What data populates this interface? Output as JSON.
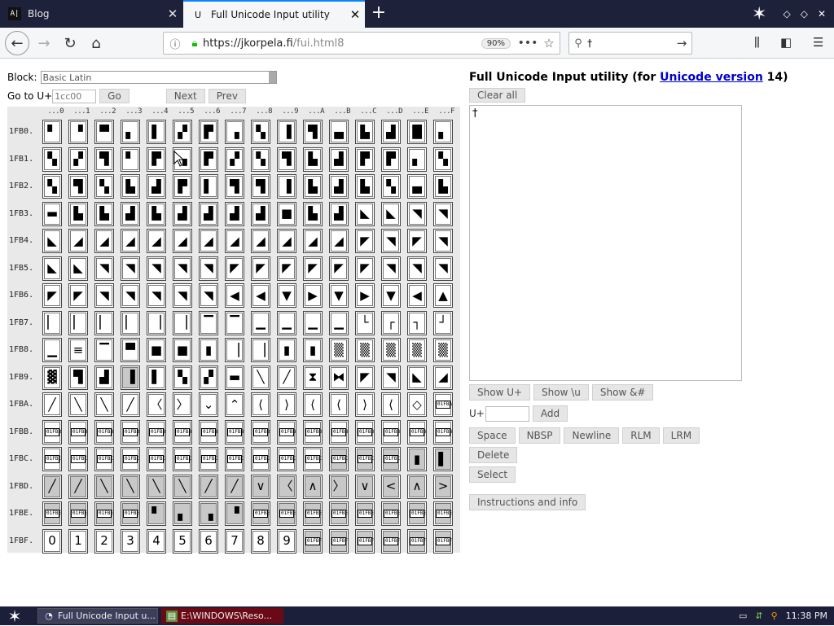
{
  "browser": {
    "tabs": [
      {
        "title": "Blog",
        "favicon": "A|"
      },
      {
        "title": "Full Unicode Input utility",
        "favicon": "U"
      }
    ],
    "url_prefix": "https://jkorpela.fi",
    "url_path": "/fui.html8",
    "zoom": "90%",
    "search_value": "†"
  },
  "page": {
    "block_label": "Block:",
    "block_value": "Basic Latin",
    "goto_label": "Go to U+",
    "goto_value": "1cc00",
    "go_label": "Go",
    "next_label": "Next",
    "prev_label": "Prev",
    "title_prefix": "Full Unicode Input utility (for ",
    "title_link": "Unicode version",
    "title_suffix": " 14)",
    "clear_label": "Clear all",
    "textarea_value": "†",
    "show_buttons": [
      "Show U+",
      "Show \\u",
      "Show &#"
    ],
    "add_prefix": "U+",
    "add_label": "Add",
    "insert_buttons": [
      "Space",
      "NBSP",
      "Newline",
      "RLM",
      "LRM"
    ],
    "delete_label": "Delete",
    "select_label": "Select",
    "instructions_label": "Instructions and info"
  },
  "grid": {
    "column_headers": [
      "...0",
      "...1",
      "...2",
      "...3",
      "...4",
      "...5",
      "...6",
      "...7",
      "...8",
      "...9",
      "...A",
      "...B",
      "...C",
      "...D",
      "...E",
      "...F"
    ],
    "rows": [
      {
        "label": "1FB0.",
        "cells": [
          "▘",
          "▝",
          "▀",
          "▖",
          "▌",
          "▞",
          "▛",
          "▗",
          "▚",
          "▐",
          "▜",
          "▄",
          "▙",
          "▟",
          "█",
          "▖"
        ],
        "shaded": []
      },
      {
        "label": "1FB1.",
        "cells": [
          "▚",
          "▞",
          "▜",
          "▘",
          "▛",
          "▗",
          "▛",
          "▞",
          "▚",
          "▜",
          "▙",
          "▟",
          "▛",
          "▛",
          "▖",
          "▚"
        ],
        "shaded": []
      },
      {
        "label": "1FB2.",
        "cells": [
          "▚",
          "▜",
          "▚",
          "▙",
          "▟",
          "▛",
          "▌",
          "▜",
          "▜",
          "▐",
          "▙",
          "▟",
          "▙",
          "▚",
          "▄",
          "▙"
        ],
        "shaded": []
      },
      {
        "label": "1FB3.",
        "cells": [
          "▬",
          "▙",
          "▙",
          "▟",
          "▙",
          "▟",
          "▟",
          "▟",
          "▟",
          "■",
          "▙",
          "▟",
          "◣",
          "◣",
          "◥",
          "◥"
        ],
        "shaded": []
      },
      {
        "label": "1FB4.",
        "cells": [
          "◣",
          "◢",
          "◢",
          "◢",
          "◢",
          "◢",
          "◢",
          "◢",
          "◢",
          "◢",
          "◢",
          "◢",
          "◤",
          "◥",
          "◤",
          "◥"
        ],
        "shaded": []
      },
      {
        "label": "1FB5.",
        "cells": [
          "◣",
          "◣",
          "◥",
          "◥",
          "◥",
          "◥",
          "◥",
          "◤",
          "◤",
          "◤",
          "◤",
          "◤",
          "◤",
          "◥",
          "◥",
          "◥"
        ],
        "shaded": []
      },
      {
        "label": "1FB6.",
        "cells": [
          "◤",
          "◤",
          "◥",
          "◥",
          "◥",
          "◥",
          "◥",
          "◀",
          "◀",
          "▼",
          "▶",
          "▼",
          "▶",
          "▼",
          "◀",
          "▲"
        ],
        "shaded": []
      },
      {
        "label": "1FB7.",
        "cells": [
          "▏",
          "▏",
          "▏",
          "▏",
          "▕",
          "▕",
          "▔",
          "▔",
          "▁",
          "▁",
          "▁",
          "▁",
          "└",
          "┌",
          "┐",
          "┘"
        ],
        "shaded": []
      },
      {
        "label": "1FB8.",
        "cells": [
          "▁",
          "≡",
          "▔",
          "▀",
          "■",
          "■",
          "▮",
          "▕",
          "▕",
          "▮",
          "▮",
          "▒",
          "▒",
          "▒",
          "▒",
          "▒"
        ],
        "shaded": []
      },
      {
        "label": "1FB9.",
        "cells": [
          "▓",
          "▜",
          "▟",
          "▐",
          "▌",
          "▚",
          "▞",
          "▬",
          "╲",
          "╱",
          "⧗",
          "⧓",
          "◤",
          "◥",
          "◣",
          "◢"
        ],
        "shaded": [
          3
        ]
      },
      {
        "label": "1FBA.",
        "cells": [
          "╱",
          "╲",
          "╲",
          "╱",
          "〈",
          "〉",
          "⌄",
          "⌃",
          "⟨",
          "⟩",
          "⟨",
          "⟨",
          "⟩",
          "⟨",
          "◇",
          "01FBAF"
        ],
        "shaded": []
      },
      {
        "label": "1FBB.",
        "cells": [
          "01FBB0",
          "01FBB1",
          "01FBB2",
          "01FBB3",
          "01FBB4",
          "01FBB5",
          "01FBB6",
          "01FBB7",
          "01FBB8",
          "01FBB9",
          "01FBBA",
          "01FBBB",
          "01FBBC",
          "01FBBD",
          "01FBBE",
          "01FBBF"
        ],
        "shaded": []
      },
      {
        "label": "1FBC.",
        "cells": [
          "01FBC0",
          "01FBC1",
          "01FBC2",
          "01FBC3",
          "01FBC4",
          "01FBC5",
          "01FBC6",
          "01FBC7",
          "01FBC8",
          "01FBC9",
          "01FBCA",
          "01FBCB",
          "01FBCC",
          "01FBCD",
          "▮",
          "▌"
        ],
        "shaded": [
          11,
          12,
          13,
          14,
          15
        ]
      },
      {
        "label": "1FBD.",
        "cells": [
          "╱",
          "╱",
          "╲",
          "╲",
          "╲",
          "╲",
          "╱",
          "╱",
          "∨",
          "〈",
          "∧",
          "〉",
          "∨",
          "<",
          "∧",
          ">"
        ],
        "shaded": [
          0,
          1,
          2,
          3,
          4,
          5,
          6,
          7,
          8,
          9,
          10,
          11,
          12,
          13,
          14,
          15
        ]
      },
      {
        "label": "1FBE.",
        "cells": [
          "01FBE0",
          "01FBE1",
          "01FBE2",
          "01FBE3",
          "▘",
          "▖",
          "▗",
          "▝",
          "01FBE8",
          "01FBE9",
          "01FBEA",
          "01FBEB",
          "01FBEC",
          "01FBED",
          "01FBEE",
          "01FBEF"
        ],
        "shaded": [
          0,
          1,
          2,
          3,
          4,
          5,
          6,
          7,
          8,
          9,
          10,
          11,
          12,
          13,
          14,
          15
        ]
      },
      {
        "label": "1FBF.",
        "cells": [
          "0",
          "1",
          "2",
          "3",
          "4",
          "5",
          "6",
          "7",
          "8",
          "9",
          "01FBFA",
          "01FBFB",
          "01FBFC",
          "01FBFD",
          "01FBFE",
          "01FBFF"
        ],
        "shaded": [
          10,
          11,
          12,
          13,
          14,
          15
        ]
      }
    ]
  },
  "taskbar": {
    "items": [
      "Full Unicode Input u...",
      "E:\\WINDOWS\\Reso..."
    ],
    "clock": "11:38 PM"
  },
  "icons": {
    "back": "back-arrow-icon",
    "forward": "forward-arrow-icon",
    "reload": "reload-icon",
    "home": "home-icon",
    "lock": "lock-icon",
    "bookmark": "star-icon",
    "search": "search-icon",
    "library": "library-icon",
    "sidebar": "sidebar-icon",
    "menu": "hamburger-menu-icon"
  },
  "colors": {
    "tabbar": "#1d2139",
    "taskbar": "#1c1f3a",
    "link": "#0000cc",
    "lock": "#12bc00"
  }
}
